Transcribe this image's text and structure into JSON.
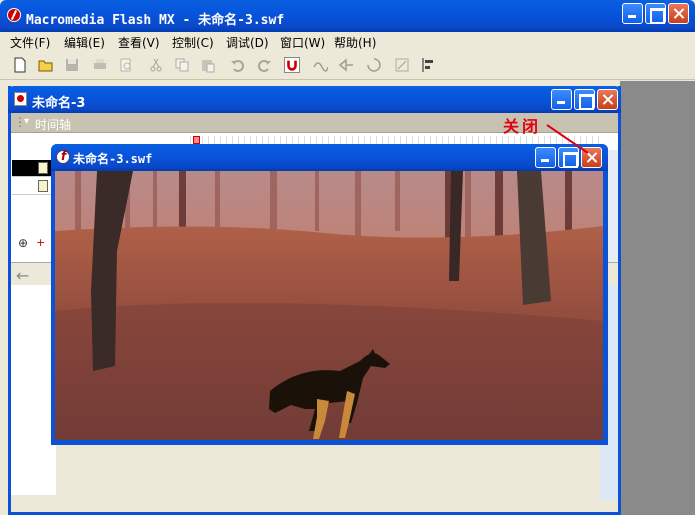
{
  "app": {
    "title": "Macromedia Flash MX - 未命名-3.swf"
  },
  "menu": [
    "文件(F)",
    "编辑(E)",
    "查看(V)",
    "控制(C)",
    "调试(D)",
    "窗口(W)",
    "帮助(H)"
  ],
  "toolbar": [
    "new-icon",
    "open-icon",
    "save-icon",
    "print-icon",
    "print-preview-icon",
    "cut-icon",
    "copy-icon",
    "paste-icon",
    "undo-icon",
    "redo-icon",
    "snap-magnet-icon",
    "smooth-icon",
    "straighten-icon",
    "rotate-icon",
    "scale-icon",
    "align-icon"
  ],
  "doc": {
    "title": "未命名-3",
    "timeline_label": "时间轴"
  },
  "swf": {
    "title": "未命名-3.swf"
  },
  "annotation": {
    "text": "关闭"
  },
  "colors": {
    "xp_blue": "#0b52d6",
    "close_red": "#d8502a",
    "annotation_red": "#e00010"
  }
}
